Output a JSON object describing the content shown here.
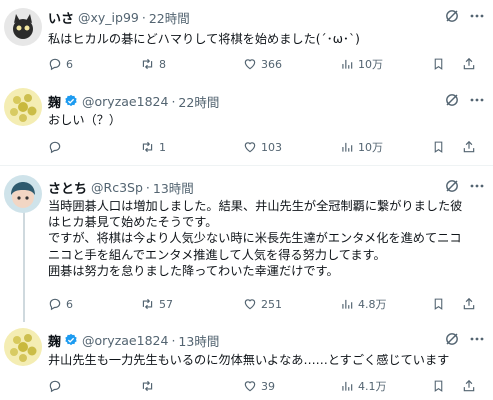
{
  "tweets": [
    {
      "name": "いさ",
      "handle": "@xy_ip99",
      "time": "22時間",
      "lines": [
        "私はヒカルの碁にどハマりして将棋を始めました(´･ω･`)"
      ],
      "replies": "6",
      "reposts": "8",
      "likes": "366",
      "views": "10万"
    },
    {
      "name": "麹",
      "handle": "@oryzae1824",
      "time": "22時間",
      "lines": [
        "おしい（？）"
      ],
      "replies": "",
      "reposts": "1",
      "likes": "103",
      "views": "10万"
    },
    {
      "name": "さとち",
      "handle": "@Rc3Sp",
      "time": "13時間",
      "lines": [
        "当時囲碁人口は増加しました。結果、井山先生が全冠制覇に繋がりました彼",
        "はヒカ碁見て始めたそうです。",
        "ですが、将棋は今より人気少ない時に米長先生達がエンタメ化を進めてニコ",
        "ニコと手を組んでエンタメ推進して人気を得る努力してます。",
        "囲碁は努力を怠りました降ってわいた幸運だけです。"
      ],
      "replies": "6",
      "reposts": "57",
      "likes": "251",
      "views": "4.8万"
    },
    {
      "name": "麹",
      "handle": "@oryzae1824",
      "time": "13時間",
      "lines": [
        "井山先生も一力先生もいるのに勿体無いよなあ……とすごく感じています"
      ],
      "replies": "",
      "reposts": "",
      "likes": "39",
      "views": "4.1万"
    }
  ],
  "icons": {
    "reply": "reply-icon",
    "repost": "repost-icon",
    "like": "like-icon",
    "views": "views-icon",
    "bookmark": "bookmark-icon",
    "share": "share-icon",
    "grok": "grok-icon",
    "more": "more-icon",
    "verified": "verified-badge-icon"
  },
  "colors": {
    "text": "#0f1419",
    "secondary": "#536471",
    "verified": "#1d9bf0",
    "separator": "#eff3f4"
  }
}
